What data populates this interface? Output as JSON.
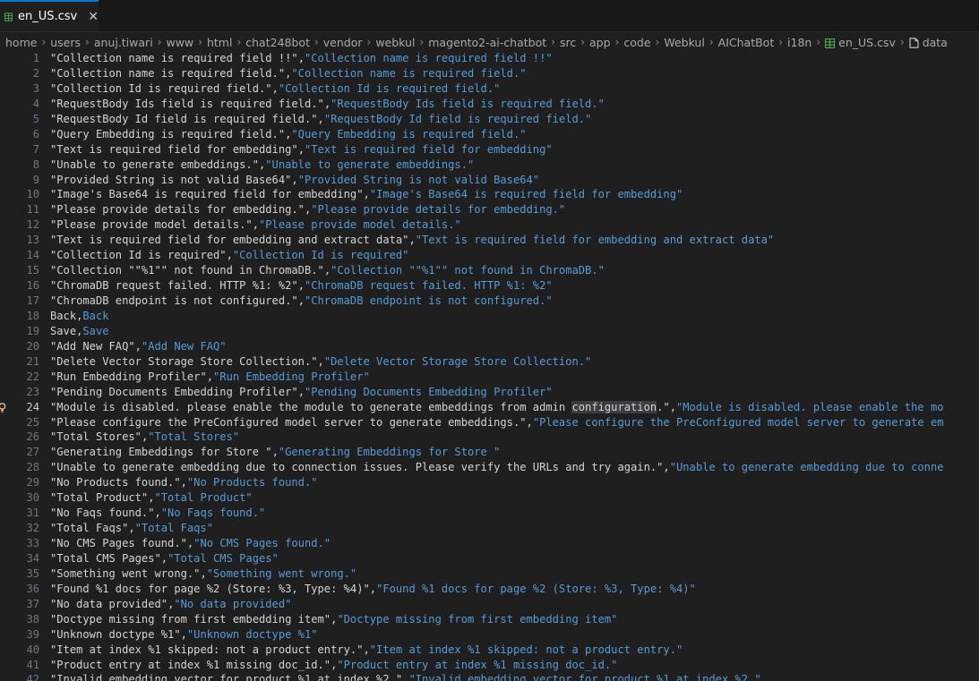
{
  "tab": {
    "label": "en_US.csv",
    "close": "✕"
  },
  "breadcrumb": [
    "home",
    "users",
    "anuj.tiwari",
    "www",
    "html",
    "chat248bot",
    "vendor",
    "webkul",
    "magento2-ai-chatbot",
    "src",
    "app",
    "code",
    "Webkul",
    "AIChatBot",
    "i18n",
    "en_US.csv",
    "data"
  ],
  "colors": {
    "key": "#d4d4d4",
    "value": "#569cd6",
    "accent": "#0078d4",
    "csv_icon": "#4caf50"
  },
  "active_line": 24,
  "highlight_word": "configuration",
  "lines": [
    {
      "n": "1",
      "k": "\"Collection name is required field !!\"",
      "v": "\"Collection name is required field !!\""
    },
    {
      "n": "2",
      "k": "\"Collection name is required field.\"",
      "v": "\"Collection name is required field.\""
    },
    {
      "n": "3",
      "k": "\"Collection Id is required field.\"",
      "v": "\"Collection Id is required field.\""
    },
    {
      "n": "4",
      "k": "\"RequestBody Ids field is required field.\"",
      "v": "\"RequestBody Ids field is required field.\""
    },
    {
      "n": "5",
      "k": "\"RequestBody Id field is required field.\"",
      "v": "\"RequestBody Id field is required field.\""
    },
    {
      "n": "6",
      "k": "\"Query Embedding is required field.\"",
      "v": "\"Query Embedding is required field.\""
    },
    {
      "n": "7",
      "k": "\"Text is required field for embedding\"",
      "v": "\"Text is required field for embedding\""
    },
    {
      "n": "8",
      "k": "\"Unable to generate embeddings.\"",
      "v": "\"Unable to generate embeddings.\""
    },
    {
      "n": "9",
      "k": "\"Provided String is not valid Base64\"",
      "v": "\"Provided String is not valid Base64\""
    },
    {
      "n": "10",
      "k": "\"Image's Base64 is required field for embedding\"",
      "v": "\"Image's Base64 is required field for embedding\""
    },
    {
      "n": "11",
      "k": "\"Please provide details for embedding.\"",
      "v": "\"Please provide details for embedding.\""
    },
    {
      "n": "12",
      "k": "\"Please provide model details.\"",
      "v": "\"Please provide model details.\""
    },
    {
      "n": "13",
      "k": "\"Text is required field for embedding and extract data\"",
      "v": "\"Text is required field for embedding and extract data\""
    },
    {
      "n": "14",
      "k": "\"Collection Id is required\"",
      "v": "\"Collection Id is required\""
    },
    {
      "n": "15",
      "k": "\"Collection \"\"%1\"\" not found in ChromaDB.\"",
      "v": "\"Collection \"\"%1\"\" not found in ChromaDB.\""
    },
    {
      "n": "16",
      "k": "\"ChromaDB request failed. HTTP %1: %2\"",
      "v": "\"ChromaDB request failed. HTTP %1: %2\""
    },
    {
      "n": "17",
      "k": "\"ChromaDB endpoint is not configured.\"",
      "v": "\"ChromaDB endpoint is not configured.\""
    },
    {
      "n": "18",
      "k": "Back",
      "v": "Back"
    },
    {
      "n": "19",
      "k": "Save",
      "v": "Save"
    },
    {
      "n": "20",
      "k": "\"Add New FAQ\"",
      "v": "\"Add New FAQ\""
    },
    {
      "n": "21",
      "k": "\"Delete Vector Storage Store Collection.\"",
      "v": "\"Delete Vector Storage Store Collection.\""
    },
    {
      "n": "22",
      "k": "\"Run Embedding Profiler\"",
      "v": "\"Run Embedding Profiler\""
    },
    {
      "n": "23",
      "k": "\"Pending Documents Embedding Profiler\"",
      "v": "\"Pending Documents Embedding Profiler\""
    },
    {
      "n": "24",
      "k": "\"Module is disabled. please enable the module to generate embeddings from admin configuration.\"",
      "v": "\"Module is disabled. please enable the mo"
    },
    {
      "n": "25",
      "k": "\"Please configure the PreConfigured model server to generate embeddings.\"",
      "v": "\"Please configure the PreConfigured model server to generate em"
    },
    {
      "n": "26",
      "k": "\"Total Stores\"",
      "v": "\"Total Stores\""
    },
    {
      "n": "27",
      "k": "\"Generating Embeddings for Store \"",
      "v": "\"Generating Embeddings for Store \""
    },
    {
      "n": "28",
      "k": "\"Unable to generate embedding due to connection issues. Please verify the URLs and try again.\"",
      "v": "\"Unable to generate embedding due to conne"
    },
    {
      "n": "29",
      "k": "\"No Products found.\"",
      "v": "\"No Products found.\""
    },
    {
      "n": "30",
      "k": "\"Total Product\"",
      "v": "\"Total Product\""
    },
    {
      "n": "31",
      "k": "\"No Faqs found.\"",
      "v": "\"No Faqs found.\""
    },
    {
      "n": "32",
      "k": "\"Total Faqs\"",
      "v": "\"Total Faqs\""
    },
    {
      "n": "33",
      "k": "\"No CMS Pages found.\"",
      "v": "\"No CMS Pages found.\""
    },
    {
      "n": "34",
      "k": "\"Total CMS Pages\"",
      "v": "\"Total CMS Pages\""
    },
    {
      "n": "35",
      "k": "\"Something went wrong.\"",
      "v": "\"Something went wrong.\""
    },
    {
      "n": "36",
      "k": "\"Found %1 docs for page %2 (Store: %3, Type: %4)\"",
      "v": "\"Found %1 docs for page %2 (Store: %3, Type: %4)\""
    },
    {
      "n": "37",
      "k": "\"No data provided\"",
      "v": "\"No data provided\""
    },
    {
      "n": "38",
      "k": "\"Doctype missing from first embedding item\"",
      "v": "\"Doctype missing from first embedding item\""
    },
    {
      "n": "39",
      "k": "\"Unknown doctype %1\"",
      "v": "\"Unknown doctype %1\""
    },
    {
      "n": "40",
      "k": "\"Item at index %1 skipped: not a product entry.\"",
      "v": "\"Item at index %1 skipped: not a product entry.\""
    },
    {
      "n": "41",
      "k": "\"Product entry at index %1 missing doc_id.\"",
      "v": "\"Product entry at index %1 missing doc_id.\""
    },
    {
      "n": "42",
      "k": "\"Invalid embedding vector for product %1 at index %2.\"",
      "v": "\"Invalid embedding vector for product %1 at index %2.\""
    }
  ]
}
